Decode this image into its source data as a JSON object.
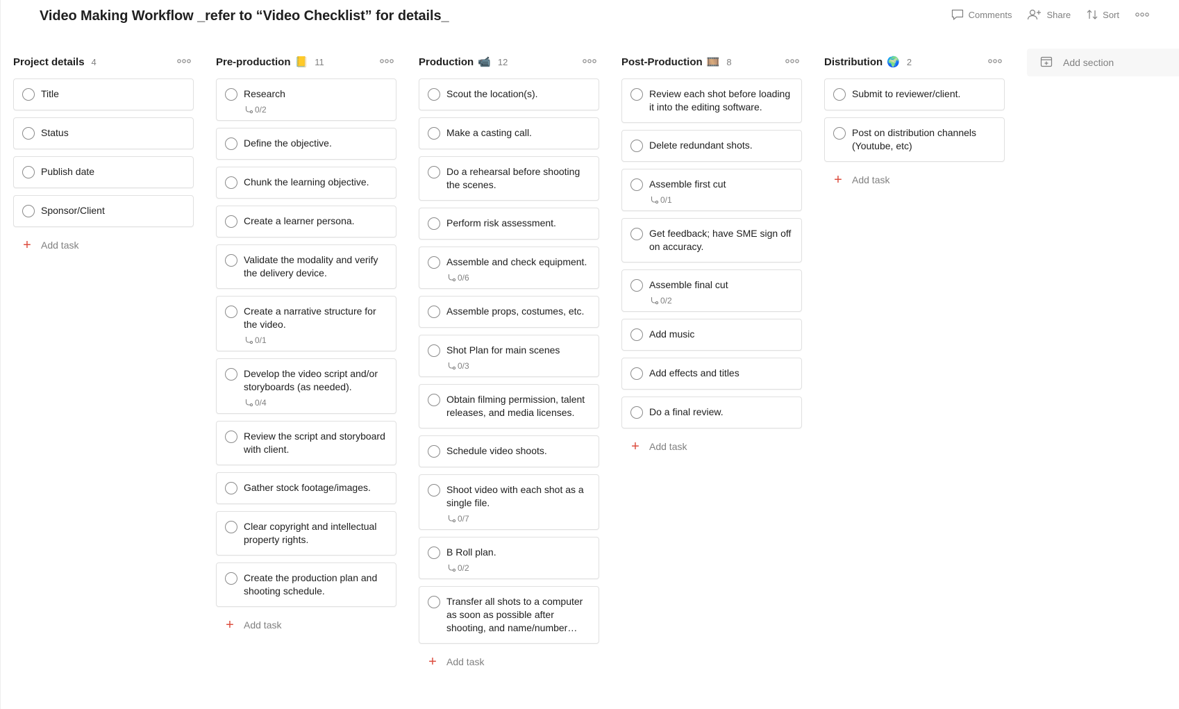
{
  "header": {
    "title": "Video Making Workflow _refer to “Video Checklist” for details_",
    "comments_label": "Comments",
    "share_label": "Share",
    "sort_label": "Sort"
  },
  "add_section_label": "Add section",
  "add_task_label": "Add task",
  "columns": [
    {
      "title": "Project details",
      "emoji": "",
      "count": "4",
      "tasks": [
        {
          "name": "Title",
          "sub": ""
        },
        {
          "name": "Status",
          "sub": ""
        },
        {
          "name": "Publish date",
          "sub": ""
        },
        {
          "name": "Sponsor/Client",
          "sub": ""
        }
      ]
    },
    {
      "title": "Pre-production",
      "emoji": "📒",
      "count": "11",
      "tasks": [
        {
          "name": "Research",
          "sub": "0/2"
        },
        {
          "name": "Define the objective.",
          "sub": ""
        },
        {
          "name": "Chunk the learning objective.",
          "sub": ""
        },
        {
          "name": "Create a learner persona.",
          "sub": ""
        },
        {
          "name": "Validate the modality and verify the delivery device.",
          "sub": ""
        },
        {
          "name": "Create a narrative structure for the video.",
          "sub": "0/1"
        },
        {
          "name": "Develop the video script and/or storyboards (as needed).",
          "sub": "0/4"
        },
        {
          "name": "Review the script and storyboard with client.",
          "sub": ""
        },
        {
          "name": "Gather stock footage/images.",
          "sub": ""
        },
        {
          "name": "Clear copyright and intellectual property rights.",
          "sub": ""
        },
        {
          "name": "Create the production plan and shooting schedule.",
          "sub": ""
        }
      ]
    },
    {
      "title": "Production",
      "emoji": "📹",
      "count": "12",
      "tasks": [
        {
          "name": "Scout the location(s).",
          "sub": ""
        },
        {
          "name": "Make a casting call.",
          "sub": ""
        },
        {
          "name": "Do a rehearsal before shooting the scenes.",
          "sub": ""
        },
        {
          "name": "Perform risk assessment.",
          "sub": ""
        },
        {
          "name": "Assemble and check equipment.",
          "sub": "0/6"
        },
        {
          "name": "Assemble props, costumes, etc.",
          "sub": ""
        },
        {
          "name": "Shot Plan for main scenes",
          "sub": "0/3"
        },
        {
          "name": "Obtain filming permission, talent releases, and media licenses.",
          "sub": ""
        },
        {
          "name": "Schedule video shoots.",
          "sub": ""
        },
        {
          "name": "Shoot video with each shot as a single file.",
          "sub": "0/7"
        },
        {
          "name": "B Roll plan.",
          "sub": "0/2"
        },
        {
          "name": "Transfer all shots to a computer as soon as possible after shooting, and name/number…",
          "sub": ""
        }
      ]
    },
    {
      "title": "Post-Production",
      "emoji": "🎞️",
      "count": "8",
      "tasks": [
        {
          "name": "Review each shot before loading it into the editing software.",
          "sub": ""
        },
        {
          "name": "Delete redundant shots.",
          "sub": ""
        },
        {
          "name": "Assemble first cut",
          "sub": "0/1"
        },
        {
          "name": "Get feedback; have SME sign off on accuracy.",
          "sub": ""
        },
        {
          "name": "Assemble final cut",
          "sub": "0/2"
        },
        {
          "name": "Add music",
          "sub": ""
        },
        {
          "name": "Add effects and titles",
          "sub": ""
        },
        {
          "name": "Do a final review.",
          "sub": ""
        }
      ]
    },
    {
      "title": "Distribution",
      "emoji": "🌍",
      "count": "2",
      "tasks": [
        {
          "name": "Submit to reviewer/client.",
          "sub": ""
        },
        {
          "name": "Post on distribution channels (Youtube, etc)",
          "sub": ""
        }
      ]
    }
  ],
  "colors": {
    "accent": "#dc4c3e",
    "muted": "#808080",
    "border": "#e0e0e0"
  }
}
